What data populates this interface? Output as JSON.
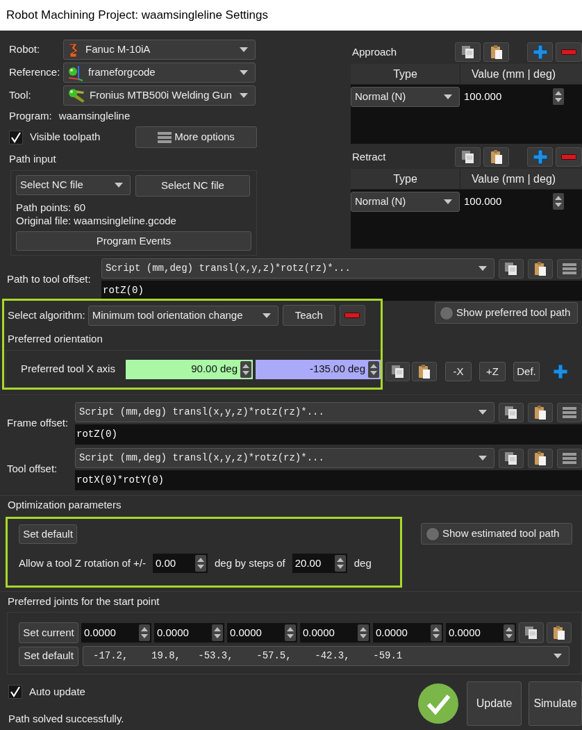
{
  "window": {
    "title": "Robot Machining Project: waamsingleline Settings"
  },
  "selectors": [
    {
      "label": "Robot:",
      "value": "Fanuc M-10iA",
      "kind": "robot"
    },
    {
      "label": "Reference:",
      "value": "frameforgcode",
      "kind": "frame"
    },
    {
      "label": "Tool:",
      "value": "Fronius MTB500i Welding Gun",
      "kind": "tool"
    }
  ],
  "program": {
    "label": "Program:",
    "value": "waamsingleline"
  },
  "visible_toolpath": {
    "label": "Visible toolpath",
    "checked": true
  },
  "more_options_button": "More options",
  "path_input": {
    "title": "Path input",
    "dropdown": "Select NC file",
    "button": "Select NC file",
    "path_points": "Path points: 60",
    "original_file": "Original file: waamsingleline.gcode",
    "events_button": "Program Events"
  },
  "moves": [
    {
      "title": "Approach",
      "columns": [
        "Type",
        "Value (mm | deg)"
      ],
      "rows": [
        {
          "type": "Normal (N)",
          "value": "100.000"
        }
      ]
    },
    {
      "title": "Retract",
      "columns": [
        "Type",
        "Value (mm | deg)"
      ],
      "rows": [
        {
          "type": "Normal (N)",
          "value": "100.000"
        }
      ]
    }
  ],
  "path_to_tool_offset": {
    "label": "Path to tool offset:",
    "script": "Script (mm,deg) transl(x,y,z)*rotz(rz)*...",
    "value": "rotZ(0)"
  },
  "algorithm": {
    "highlighted": true,
    "label": "Select algorithm:",
    "value": "Minimum tool orientation change",
    "teach_button": "Teach",
    "show_preferred": {
      "label": "Show preferred tool path",
      "on": false
    },
    "orientation_title": "Preferred orientation",
    "axis_label": "Preferred tool X axis",
    "angles": [
      {
        "value": "90.00 deg",
        "color": "#aaf7a6"
      },
      {
        "value": "-135.00 deg",
        "color": "#aaaaf8"
      }
    ],
    "buttons": [
      "-X",
      "+Z",
      "Def."
    ]
  },
  "frame_offset": {
    "label": "Frame offset:",
    "script": "Script (mm,deg) transl(x,y,z)*rotz(rz)*...",
    "value": "rotZ(0)"
  },
  "tool_offset": {
    "label": "Tool offset:",
    "script": "Script (mm,deg) transl(x,y,z)*rotz(rz)*...",
    "value": "rotX(0)*rotY(0)"
  },
  "optimization": {
    "title": "Optimization parameters",
    "highlighted": true,
    "set_default_button": "Set default",
    "show_estimated": {
      "label": "Show estimated tool path",
      "on": false
    },
    "rotation_label": "Allow a tool Z rotation of +/-",
    "rotation": "0.00",
    "steps_label": "deg by steps of",
    "steps": "20.00",
    "unit": "deg"
  },
  "joints": {
    "title": "Preferred joints for the start point",
    "set_current_button": "Set current",
    "values": [
      "0.0000",
      "0.0000",
      "0.0000",
      "0.0000",
      "0.0000",
      "0.0000"
    ],
    "set_default_button": "Set default",
    "default_values": "-17.2,    19.8,   -53.3,    -57.5,    -42.3,    -59.1"
  },
  "auto_update": {
    "label": "Auto update",
    "checked": true
  },
  "status": "Path solved successfully.",
  "solved": true,
  "buttons": [
    "Update",
    "Simulate"
  ]
}
